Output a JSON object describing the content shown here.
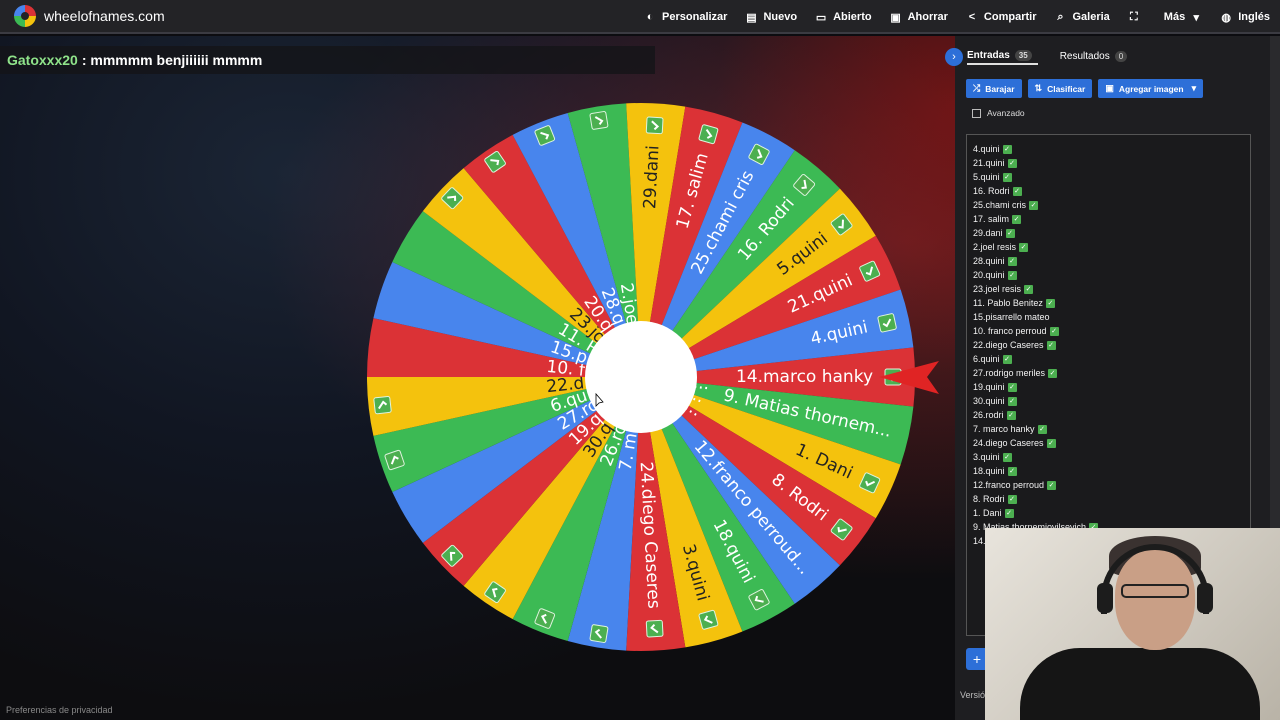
{
  "header": {
    "site_name": "wheelofnames.com",
    "nav": [
      {
        "label": "Personalizar",
        "icon": "palette-icon",
        "glyph": "◐"
      },
      {
        "label": "Nuevo",
        "icon": "new-file-icon",
        "glyph": "▤"
      },
      {
        "label": "Abierto",
        "icon": "folder-open-icon",
        "glyph": "▭"
      },
      {
        "label": "Ahorrar",
        "icon": "save-icon",
        "glyph": "▣"
      },
      {
        "label": "Compartir",
        "icon": "share-icon",
        "glyph": "<"
      },
      {
        "label": "Galeria",
        "icon": "search-icon",
        "glyph": "⌕"
      },
      {
        "label": "",
        "icon": "fullscreen-icon",
        "glyph": "⛶"
      },
      {
        "label": "Más",
        "icon": "chevron-down-icon",
        "glyph": "▾"
      },
      {
        "label": "Inglés",
        "icon": "globe-icon",
        "glyph": "◍"
      }
    ]
  },
  "chat": {
    "user": "Gatoxxx20",
    "message": ": mmmmm benjiiiiii mmmm"
  },
  "wheel": {
    "segments": [
      {
        "label": "14.marco hanky",
        "color": "#db3236",
        "check": true
      },
      {
        "label": "9. Matias thornem...",
        "color": "#3cba54",
        "check": false
      },
      {
        "label": "1. Dani",
        "color": "#f4c20d",
        "check": true
      },
      {
        "label": "8. Rodri",
        "color": "#db3236",
        "check": true
      },
      {
        "label": "12.franco perroud...",
        "color": "#4885ed",
        "check": false
      },
      {
        "label": "18.quini",
        "color": "#3cba54",
        "check": true
      },
      {
        "label": "3.quini",
        "color": "#f4c20d",
        "check": true
      },
      {
        "label": "24.diego Caseres",
        "color": "#db3236",
        "check": true
      },
      {
        "label": "7. marco hanky",
        "color": "#4885ed",
        "check": true
      },
      {
        "label": "26.rodri",
        "color": "#3cba54",
        "check": true
      },
      {
        "label": "30.quini",
        "color": "#f4c20d",
        "check": true
      },
      {
        "label": "19.quini",
        "color": "#db3236",
        "check": true
      },
      {
        "label": "27.rodrigo merile...",
        "color": "#4885ed",
        "check": false
      },
      {
        "label": "6.quini",
        "color": "#3cba54",
        "check": true
      },
      {
        "label": "22.diego Caseres",
        "color": "#f4c20d",
        "check": true
      },
      {
        "label": "10. franco perrou...",
        "color": "#db3236",
        "check": false
      },
      {
        "label": "15.pisarrello mat...",
        "color": "#4885ed",
        "check": false
      },
      {
        "label": "11. Pablo Benitez...",
        "color": "#3cba54",
        "check": false
      },
      {
        "label": "23.joel resis",
        "color": "#f4c20d",
        "check": true
      },
      {
        "label": "20.quini",
        "color": "#db3236",
        "check": true
      },
      {
        "label": "28.quini",
        "color": "#4885ed",
        "check": true
      },
      {
        "label": "2.joel resis",
        "color": "#3cba54",
        "check": true
      },
      {
        "label": "29.dani",
        "color": "#f4c20d",
        "check": true
      },
      {
        "label": "17. salim",
        "color": "#db3236",
        "check": true
      },
      {
        "label": "25.chami cris",
        "color": "#4885ed",
        "check": true
      },
      {
        "label": "16. Rodri",
        "color": "#3cba54",
        "check": true
      },
      {
        "label": "5.quini",
        "color": "#f4c20d",
        "check": true
      },
      {
        "label": "21.quini",
        "color": "#db3236",
        "check": true
      },
      {
        "label": "4.quini",
        "color": "#4885ed",
        "check": true
      }
    ]
  },
  "panel": {
    "tab_entries": "Entradas",
    "entries_count": "35",
    "tab_results": "Resultados",
    "results_count": "0",
    "shuffle": "Barajar",
    "sort": "Clasificar",
    "add_image": "Agregar imagen",
    "advanced": "Avanzado",
    "entries": [
      "4.quini",
      "21.quini",
      "5.quini",
      "16. Rodri",
      "25.chami cris",
      "17. salim",
      "29.dani",
      "2.joel resis",
      "28.quini",
      "20.quini",
      "23.joel resis",
      "11. Pablo Benitez",
      "15.pisarrello mateo",
      "10. franco perroud",
      "22.diego Caseres",
      "6.quini",
      "27.rodrigo meriles",
      "19.quini",
      "30.quini",
      "26.rodri",
      "7. marco hanky",
      "24.diego Caseres",
      "3.quini",
      "18.quini",
      "12.franco perroud",
      "8. Rodri",
      "1. Dani",
      "9. Matias thornemiovilsevich",
      "14."
    ],
    "entry_checks": [
      true,
      true,
      true,
      true,
      true,
      true,
      true,
      true,
      true,
      true,
      true,
      true,
      false,
      true,
      true,
      true,
      true,
      true,
      true,
      true,
      true,
      true,
      true,
      true,
      true,
      true,
      true,
      true,
      false
    ],
    "version_label": "Versió"
  },
  "footer": {
    "privacy": "Preferencias de privacidad"
  }
}
